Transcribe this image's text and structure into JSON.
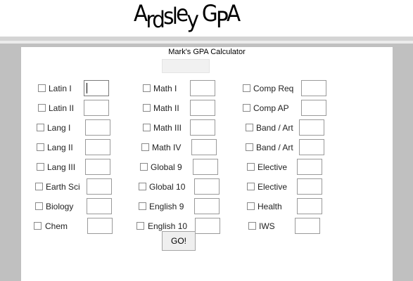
{
  "header": {
    "logo_text": "Ardsley GPA"
  },
  "calculator": {
    "title": "Mark's GPA Calculator",
    "name_value": "",
    "go_label": "GO!",
    "columns": [
      [
        {
          "label": "Latin I",
          "value": ""
        },
        {
          "label": "Latin II",
          "value": ""
        },
        {
          "label": "Lang I",
          "value": ""
        },
        {
          "label": "Lang II",
          "value": ""
        },
        {
          "label": "Lang III",
          "value": ""
        },
        {
          "label": "Earth Sci",
          "value": ""
        },
        {
          "label": "Biology",
          "value": ""
        },
        {
          "label": "Chem",
          "value": ""
        }
      ],
      [
        {
          "label": "Math I",
          "value": ""
        },
        {
          "label": "Math II",
          "value": ""
        },
        {
          "label": "Math III",
          "value": ""
        },
        {
          "label": "Math IV",
          "value": ""
        },
        {
          "label": "Global 9",
          "value": ""
        },
        {
          "label": "Global 10",
          "value": ""
        },
        {
          "label": "English 9",
          "value": ""
        },
        {
          "label": "English 10",
          "value": ""
        }
      ],
      [
        {
          "label": "Comp Req",
          "value": ""
        },
        {
          "label": "Comp AP",
          "value": ""
        },
        {
          "label": "Band / Art",
          "value": ""
        },
        {
          "label": "Band / Art",
          "value": ""
        },
        {
          "label": "Elective",
          "value": ""
        },
        {
          "label": "Elective",
          "value": ""
        },
        {
          "label": "Health",
          "value": ""
        },
        {
          "label": "IWS",
          "value": ""
        }
      ]
    ]
  }
}
